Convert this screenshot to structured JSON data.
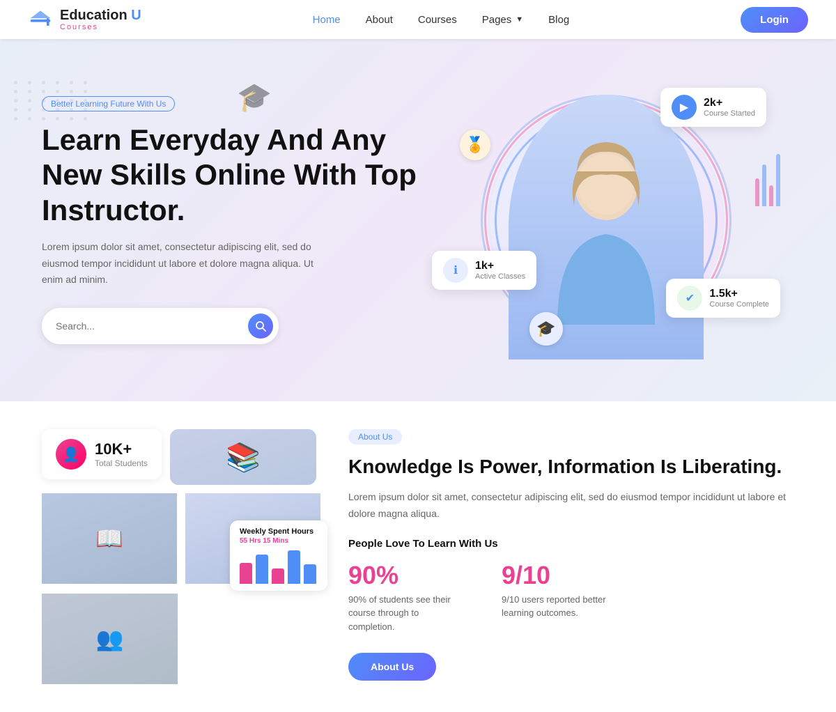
{
  "nav": {
    "logo_title_1": "Education",
    "logo_title_2": " U",
    "logo_sub": "Courses",
    "links": [
      {
        "label": "Home",
        "active": true
      },
      {
        "label": "About",
        "active": false
      },
      {
        "label": "Courses",
        "active": false
      },
      {
        "label": "Pages",
        "active": false,
        "dropdown": true
      },
      {
        "label": "Blog",
        "active": false
      }
    ],
    "login_label": "Login"
  },
  "hero": {
    "badge": "Better Learning Future With Us",
    "title": "Learn Everyday And Any New Skills Online With Top Instructor.",
    "desc": "Lorem ipsum dolor sit amet, consectetur adipiscing elit, sed do eiusmod tempor incididunt ut labore et dolore magna aliqua. Ut enim ad minim.",
    "search_placeholder": "Search...",
    "stats": {
      "courses_started": {
        "num": "2k+",
        "label": "Course Started"
      },
      "active_classes": {
        "num": "1k+",
        "label": "Active Classes"
      },
      "course_complete": {
        "num": "1.5k+",
        "label": "Course Complete"
      }
    }
  },
  "collage": {
    "students": {
      "num": "10K+",
      "label": "Total Students"
    },
    "weekly_card": {
      "title": "Weekly Spent Hours",
      "hours": "55 Hrs 15 Mins",
      "bars": [
        {
          "value": 60,
          "color": "#e84393"
        },
        {
          "value": 80,
          "color": "#4f8ef7"
        },
        {
          "value": 45,
          "color": "#e84393"
        },
        {
          "value": 90,
          "color": "#4f8ef7"
        },
        {
          "value": 55,
          "color": "#4f8ef7"
        }
      ]
    }
  },
  "about": {
    "badge": "About Us",
    "title": "Knowledge Is Power, Information Is Liberating.",
    "desc": "Lorem ipsum dolor sit amet, consectetur adipiscing elit, sed do eiusmod tempor incididunt ut labore et dolore magna aliqua.",
    "people_love": "People Love To Learn With Us",
    "stat1_num": "90%",
    "stat1_desc": "90% of students see their course through to completion.",
    "stat2_num": "9/10",
    "stat2_desc": "9/10 users reported better learning outcomes.",
    "button_label": "About Us"
  }
}
